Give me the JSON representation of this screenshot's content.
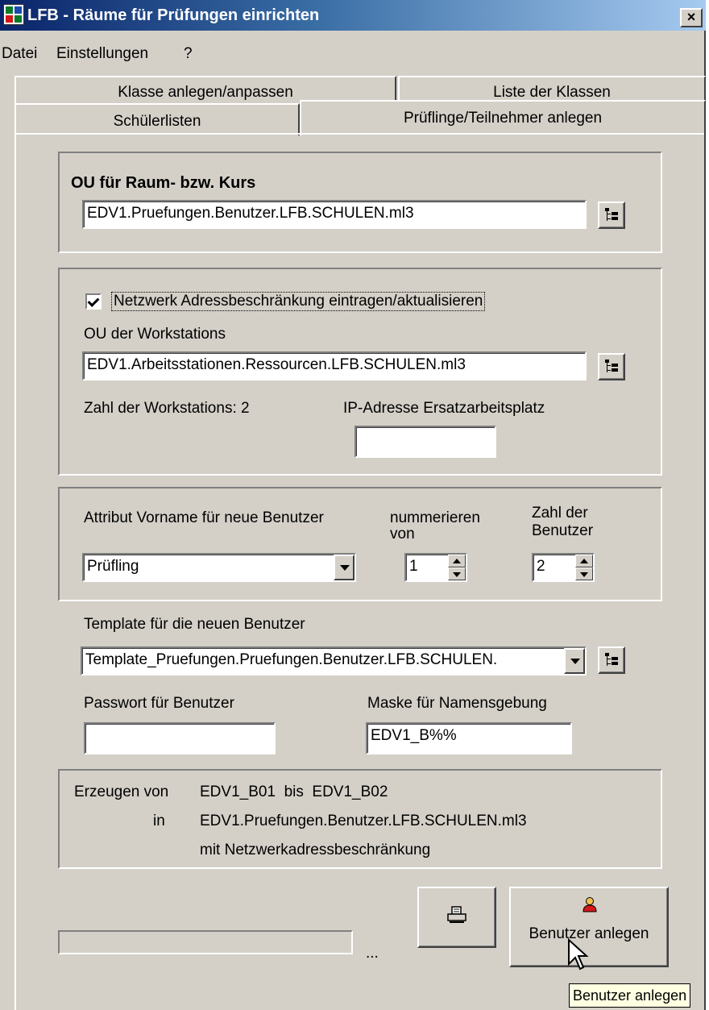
{
  "window": {
    "title": "LFB - Räume für Prüfungen einrichten",
    "close_label": "×"
  },
  "menu": {
    "items": [
      "Datei",
      "Einstellungen",
      "?"
    ]
  },
  "tabs": {
    "back_row": [
      "Klasse anlegen/anpassen",
      "Liste der Klassen"
    ],
    "front_row": [
      "Schülerlisten",
      "Prüflinge/Teilnehmer anlegen"
    ],
    "active": "Prüflinge/Teilnehmer anlegen"
  },
  "ou_section": {
    "heading": "OU für Raum- bzw. Kurs",
    "value": "EDV1.Pruefungen.Benutzer.LFB.SCHULEN.ml3"
  },
  "network_section": {
    "checkbox_label": "Netzwerk Adressbeschränkung eintragen/aktualisieren",
    "checkbox_checked": true,
    "ou_label": "OU der Workstations",
    "ou_value": "EDV1.Arbeitsstationen.Ressourcen.LFB.SCHULEN.ml3",
    "workstation_count": "Zahl der Workstations: 2",
    "ip_label": "IP-Adresse Ersatzarbeitsplatz",
    "ip_value": ""
  },
  "attribute_section": {
    "firstname_label": "Attribut Vorname für neue Benutzer",
    "firstname_value": "Prüfling",
    "numbering_label_1": "nummerieren",
    "numbering_label_2": "von",
    "numbering_value": "1",
    "count_label_1": "Zahl der",
    "count_label_2": "Benutzer",
    "count_value": "2"
  },
  "template_section": {
    "template_label": "Template für die neuen Benutzer",
    "template_value": "Template_Pruefungen.Pruefungen.Benutzer.LFB.SCHULEN.",
    "password_label": "Passwort für Benutzer",
    "password_value": "",
    "mask_label": "Maske für Namensgebung",
    "mask_value": "EDV1_B%%"
  },
  "summary": {
    "create_label": "Erzeugen von",
    "range": "EDV1_B01  bis  EDV1_B02",
    "in_label": "in",
    "target_ou": "EDV1.Pruefungen.Benutzer.LFB.SCHULEN.ml3",
    "note": "mit Netzwerkadressbeschränkung"
  },
  "actions": {
    "print_icon": "printer-icon",
    "create_icon": "user-icon",
    "create_label": "Benutzer anlegen",
    "tooltip": "Benutzer anlegen"
  },
  "status": {
    "progress_fraction": 0,
    "ellipsis": "..."
  },
  "colors": {
    "face": "#d4d0c8",
    "title_start": "#0a246a",
    "title_end": "#a6caf0",
    "tooltip_bg": "#ffffe1",
    "user_icon_red": "#d21818"
  }
}
